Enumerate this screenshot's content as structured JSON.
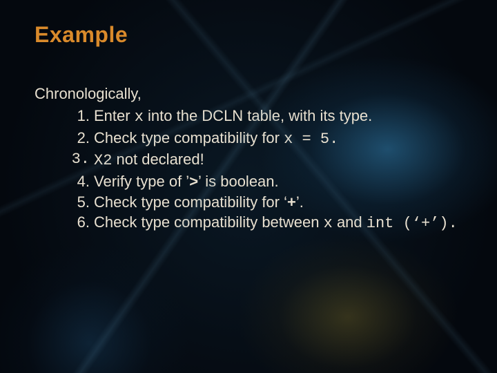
{
  "title": "Example",
  "intro": "Chronologically,",
  "steps": {
    "s1": {
      "t1": "Enter ",
      "c1": "x",
      "t2": " into the DCLN table, with its type."
    },
    "s2": {
      "t1": "Check type compatibility for ",
      "c1": " x = 5."
    },
    "s3": {
      "c1": "X2",
      "t1": " not declared!"
    },
    "s4": {
      "t1": "Verify type of ’",
      "b1": ">",
      "t2": "’ is boolean."
    },
    "s5": {
      "t1": "Check type compatibility for ‘",
      "b1": "+",
      "t2": "’."
    },
    "s6": {
      "t1": "Check type compatibility between ",
      "c1": "x",
      "t2": " and ",
      "c2": "int (‘+’)."
    }
  }
}
